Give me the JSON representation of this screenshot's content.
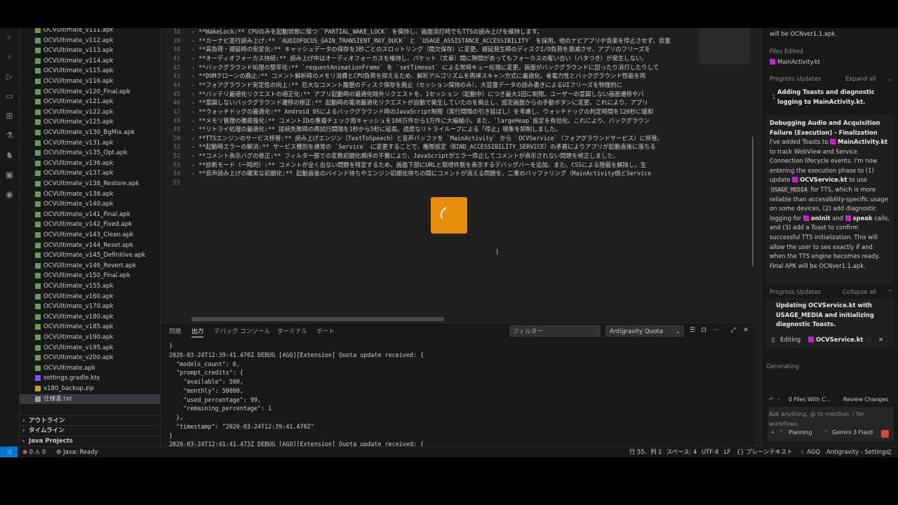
{
  "explorer": {
    "files": [
      "OCVUltimate_v111.apk",
      "OCVUltimate_v112.apk",
      "OCVUltimate_v113.apk",
      "OCVUltimate_v114.apk",
      "OCVUltimate_v115.apk",
      "OCVUltimate_v116.apk",
      "OCVUltimate_v120_Final.apk",
      "OCVUltimate_v121.apk",
      "OCVUltimate_v122.apk",
      "OCVUltimate_v125.apk",
      "OCVUltimate_v130_BgMix.apk",
      "OCVUltimate_v131.apk",
      "OCVUltimate_v135_Opt.apk",
      "OCVUltimate_v136.apk",
      "OCVUltimate_v137.apk",
      "OCVUltimate_v138_Restore.apk",
      "OCVUltimate_v138.apk",
      "OCVUltimate_v140.apk",
      "OCVUltimate_v141_Final.apk",
      "OCVUltimate_v142_Fixed.apk",
      "OCVUltimate_v143_Clean.apk",
      "OCVUltimate_v144_Reset.apk",
      "OCVUltimate_v145_Definitive.apk",
      "OCVUltimate_v146_Revert.apk",
      "OCVUltimate_v150_Final.apk",
      "OCVUltimate_v155.apk",
      "OCVUltimate_v160.apk",
      "OCVUltimate_v170.apk",
      "OCVUltimate_v180.apk",
      "OCVUltimate_v185.apk",
      "OCVUltimate_v190.apk",
      "OCVUltimate_v195.apk",
      "OCVUltimate_v200.apk",
      "OCVUltimate.apk",
      "settings.gradle.kts",
      "v180_backup.zip",
      "仕様書.txt"
    ],
    "sections": [
      "アウトライン",
      "タイムライン",
      "Java Projects"
    ]
  },
  "editor": {
    "lines": [
      {
        "n": "38",
        "t": "- **WakeLock:** CPUのみを起動状態に保つ `PARTIAL_WAKE_LOCK` を保持し、画面消灯時でもTTSの読み上げを維持します。"
      },
      {
        "n": "39",
        "t": "- **カーナビ並行読み上げ:** `AUDIOFOCUS_GAIN_TRANSIENT_MAY_DUCK` と `USAGE_ASSISTANCE_ACCESSIBILITY` を採用。他のナビアプリや音楽を停止させず、音量"
      },
      {
        "n": "40",
        "t": "- **高負荷・遅延時の安定化:** キャッシュデータの保存を3秒ごとのスロットリング（間欠保存）に変更。遅延発生時のディスクI/O負荷を激減させ、アプリのフリーズを"
      },
      {
        "n": "41",
        "t": "- **オーディオフォーカス持続:** 読み上げ中はオーディオフォーカスを維持し、パケット（文章）間に隙間があってもフォーカスの奪い合い（バタつき）が発生しない。"
      },
      {
        "n": "42",
        "t": "- **バックグラウンド処理の堅牢化:** `requestAnimationFrame` を `setTimeout` による常時キュー処理に変更。画面がバックグラウンドに回ったり消灯したりして"
      },
      {
        "n": "43",
        "t": "- **DOMクローンの廃止:** コメント解析時のメモリ消費とCPU負荷を抑えるため、解析アルゴリズムを再帰スキャン方式に最適化。省電力性とバックグラウンド性能を両"
      },
      {
        "n": "44",
        "t": "- **フォアグラウンド安定性の向上:** 巨大なコメント履歴のディスク保存を廃止（セッション保持のみ）。大容量データの読み書きによるUIフリーズを物理的に"
      },
      {
        "n": "45",
        "t": "- **バッテリ最適化リクエストの適正化:** アプリ起動時の最適化除外リクエストを、1セッション（起動中）につき最大1回に制限。ユーザーの意図しない画面遷移やバ"
      },
      {
        "n": "46",
        "t": "- **意図しないバックグラウンド遷移の修正:** 起動時の電池最適化リクエストが自動で発生していたのを廃止し、設定画面からの手動ボタンに変更。これにより、アプリ"
      },
      {
        "n": "47",
        "t": "- **ウォッチドッグの最適化:** Android OSによるバックグラウンド時のJavaScript制限（実行間隔の引き延ばし）を考慮し、ウォッチドッグの判定時間を120秒に緩和"
      },
      {
        "n": "48",
        "t": "- **メモリ管理の徹底強化:** コメントIDの重複チェック用キャッシュを100万件から1万件に大幅縮小。また、`largeHeap`設定を有効化。これにより、バックグラウン"
      },
      {
        "n": "49",
        "t": "- **リトライ処理の最適化:** 接続失敗時の再試行間隔を1秒から5秒に延長。過度なリトライループによる「停止」現象を抑制しました。"
      },
      {
        "n": "50",
        "t": "- **TTSエンジンのサービス移管:** 読み上げエンジン（TextToSpeech）と音声バッファを `MainActivity` から `OCVService`（フォアグラウンドサービス）に移管。"
      },
      {
        "n": "51",
        "t": "- **起動時エラーの解消:** サービス種別を通常の `Service` に変更することで、権限設定（BIND_ACCESSIBILITY_SERVICE）の矛盾によりアプリが起動直後に落ちる"
      },
      {
        "n": "52",
        "t": "- **コメント表示バグの修正:** フィルター部での変数初期化順序の不備により、JavaScriptがエラー停止してコメントが表示されない問題を修正しました。"
      },
      {
        "n": "53",
        "t": "- **診断モード（一時的）:** コメントが全く出ない問題を特定するため、画面下部にURLと取得件数を表示するデバッグバーを追加。また、CSSによる隠蔽を解除し、生"
      },
      {
        "n": "54",
        "t": "- **音声読み上げの確実な初期化:** 起動直後のバインド待ちやエンジン初期化待ちの間にコメントが消える問題を、二重のバッファリング（MainActivity側とService"
      },
      {
        "n": "55",
        "t": ""
      }
    ]
  },
  "panel": {
    "tabs": [
      "問題",
      "出力",
      "デバッグ コンソール",
      "ターミナル",
      "ポート"
    ],
    "active_tab": "出力",
    "filter_placeholder": "フィルター",
    "channel": "Antigravity Quota",
    "output": [
      "}",
      "2026-03-24T12:39:41.470Z DEBUG [AGQ][Extension] Quota update received: {",
      "  \"models_count\": 6,",
      "  \"prompt_credits\": {",
      "    \"available\": 500,",
      "    \"monthly\": 50000,",
      "    \"used_percentage\": 99,",
      "    \"remaining_percentage\": 1",
      "  },",
      "  \"timestamp\": \"2026-03-24T12:39:41.470Z\"",
      "}",
      "2026-03-24T12:41:41.473Z DEBUG [AGQ][Extension] Quota update received: {"
    ]
  },
  "agent": {
    "top_text": "will be OCNver1.1.apk.",
    "files_edited_label": "Files Edited",
    "files_edited_file": "MainActivity.kt",
    "progress_label_1": "Progress Updates",
    "expand_all": "Expand all",
    "progress_item_num": "1",
    "progress_item_text": "Adding Toasts and diagnostic logging to MainActivity.kt.",
    "task_title": "Debugging Audio and Acquisition Failure (Execution) - Finalization",
    "task_body": {
      "p1": "I've added Toasts to",
      "f1": "MainActivity.kt",
      "p2": "to track WebView and Service Connection lifecycle events. I'm now entering the execution phase to (1) update",
      "f2": "OCVService.kt",
      "p3": "to use",
      "chip": "USAGE_MEDIA",
      "p4": "for TTS, which is more reliable than accessibility-specific usage on some devices, (2) add diagnostic logging for",
      "f3": "onInit",
      "p5": "and",
      "f4": "speak",
      "p6": "calls, and (3) add a Toast to confirm successful TTS initialization. This will allow the user to see exactly if and when the TTS engine becomes ready. Final APK will be OCNver1.1.apk."
    },
    "progress_label_2": "Progress Updates",
    "collapse_all": "Collapse all",
    "current_update": "Updating OCVService.kt with USAGE_MEDIA and initializing diagnostic Toasts.",
    "editing_label": "Editing",
    "editing_file": "OCVService.kt",
    "generating": "Generating",
    "files_with_changes": "0 Files With C...",
    "review_changes": "Review Changes",
    "chat_placeholder": "Ask anything, @ to mention, / for workflows",
    "mode": "Planning",
    "model": "Gemini 3 Flash"
  },
  "status": {
    "errors": "0",
    "warnings": "0",
    "java": "Java: Ready",
    "position": "行 55、列 1",
    "spaces": "スペース: 4",
    "encoding": "UTF-8",
    "eol": "LF",
    "language": "{} プレーンテキスト",
    "agq": "AGQ",
    "settings": "Antigravity - Settings"
  },
  "colors": {
    "accent": "#0078d4",
    "loader": "#e88d09",
    "kotlin": "#7f52ff"
  }
}
